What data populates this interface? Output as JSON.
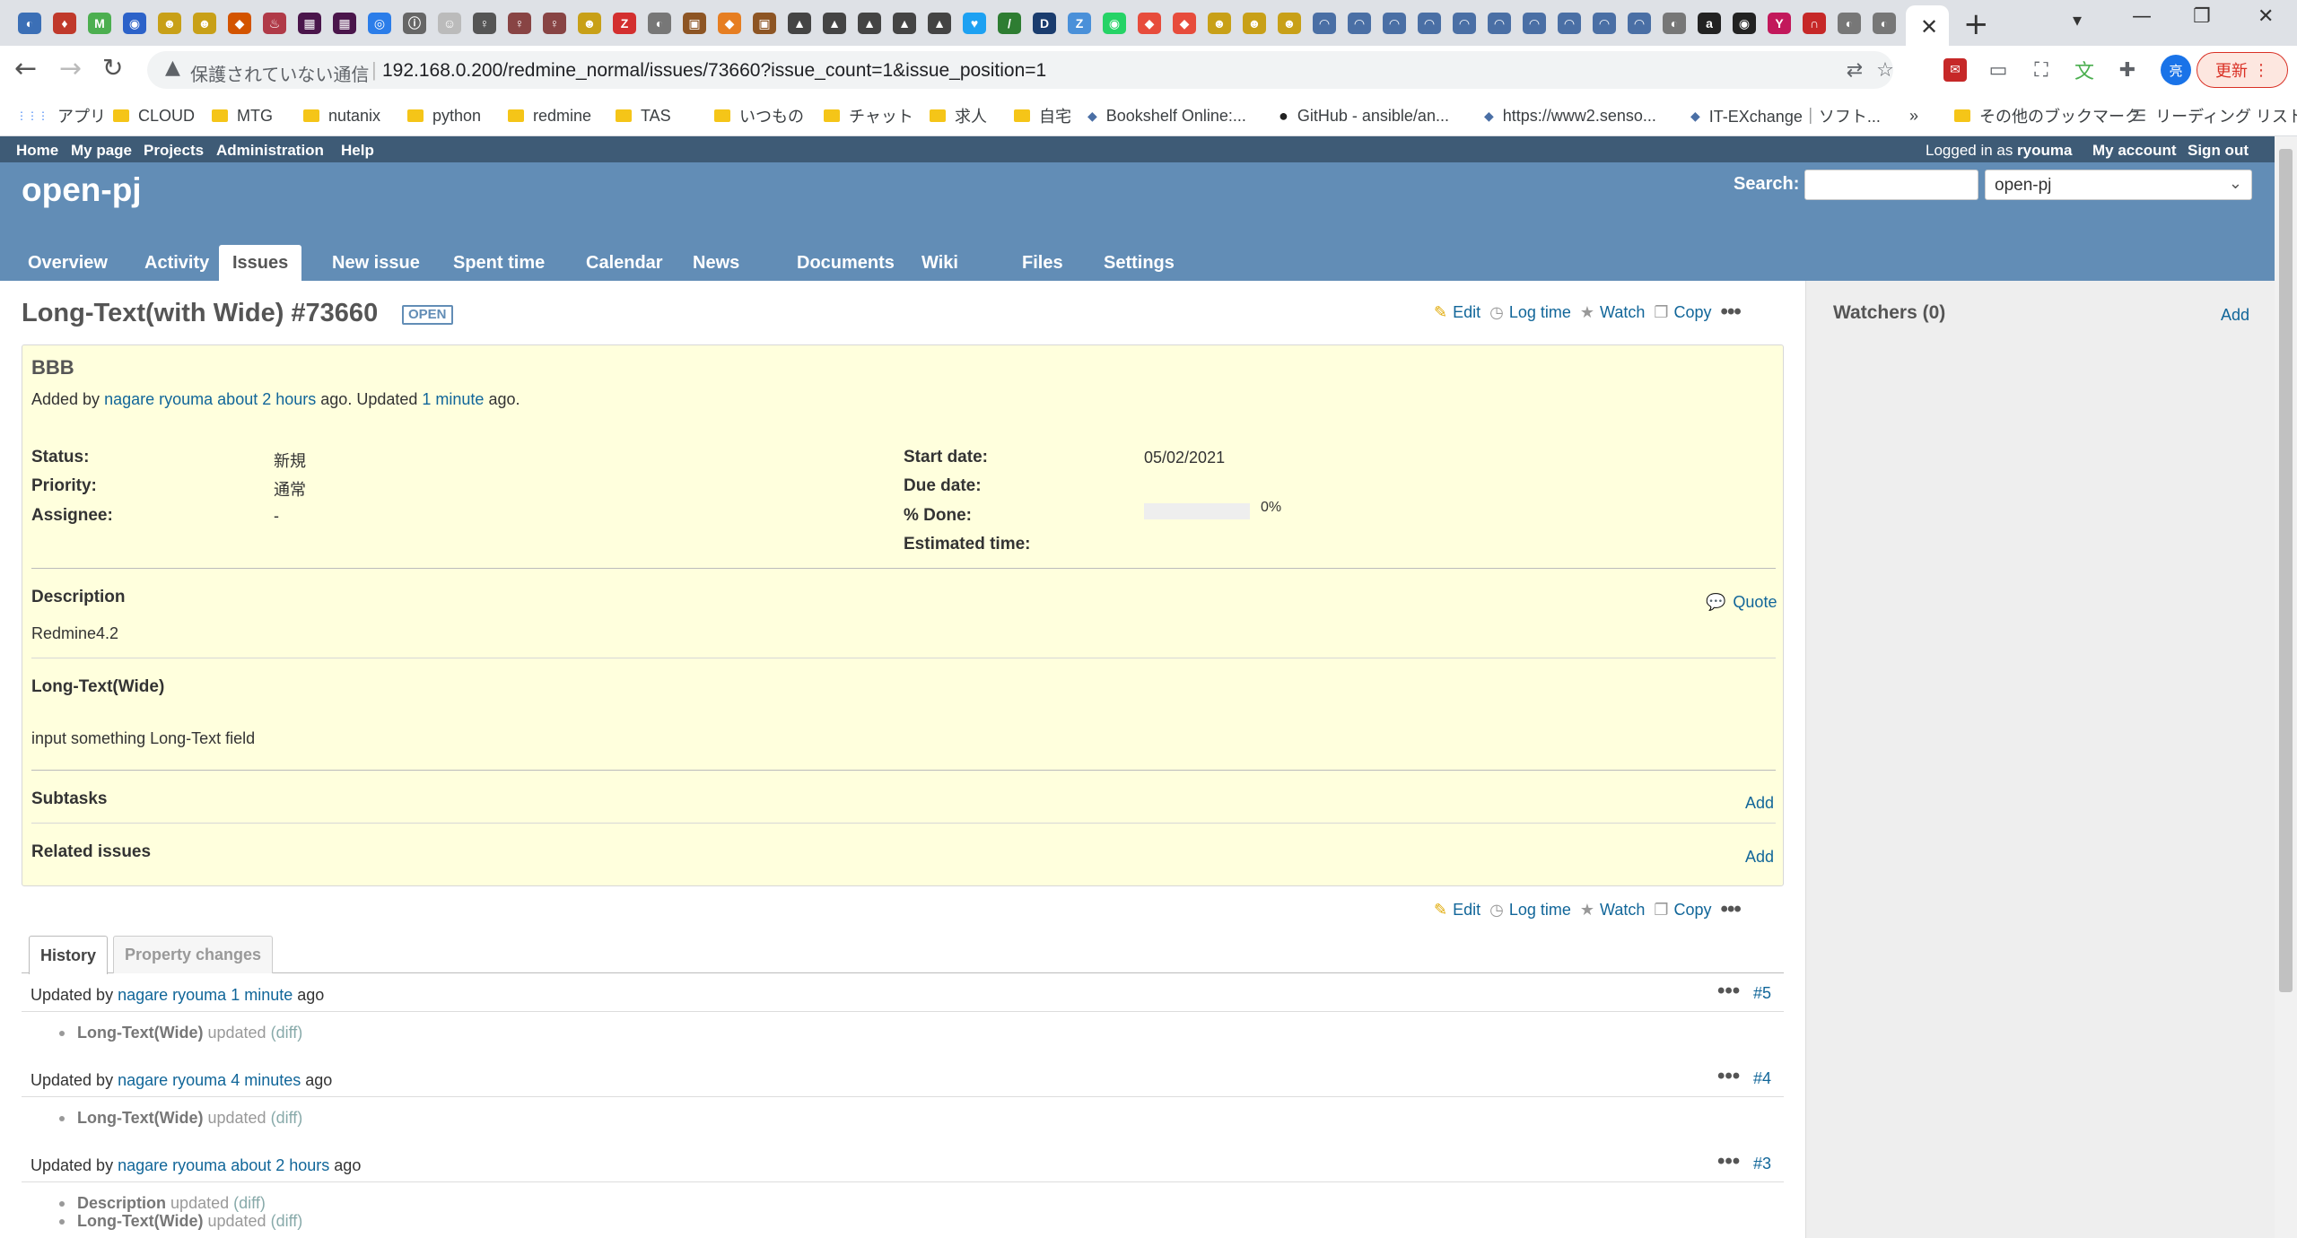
{
  "browser": {
    "window_controls": {
      "minimize": "—",
      "maximize": "❐",
      "close": "✕"
    },
    "tab_icons": [
      {
        "glyph": "◐",
        "bg": "#3b6fb6"
      },
      {
        "glyph": "♦",
        "bg": "#c0392b"
      },
      {
        "glyph": "M",
        "bg": "#4caf50"
      },
      {
        "glyph": "◉",
        "bg": "#2c62c9"
      },
      {
        "glyph": "☻",
        "bg": "#c8a018"
      },
      {
        "glyph": "☻",
        "bg": "#c8a018"
      },
      {
        "glyph": "◆",
        "bg": "#d35400"
      },
      {
        "glyph": "♨",
        "bg": "#b03a48"
      },
      {
        "glyph": "▦",
        "bg": "#4a154b"
      },
      {
        "glyph": "▦",
        "bg": "#4a154b"
      },
      {
        "glyph": "◎",
        "bg": "#2b7de9"
      },
      {
        "glyph": "ⓘ",
        "bg": "#666666"
      },
      {
        "glyph": "☺",
        "bg": "#bbbbbb"
      },
      {
        "glyph": "♀",
        "bg": "#555555"
      },
      {
        "glyph": "♀",
        "bg": "#884444"
      },
      {
        "glyph": "♀",
        "bg": "#884444"
      },
      {
        "glyph": "☻",
        "bg": "#c8a018"
      },
      {
        "glyph": "Z",
        "bg": "#d32f2f"
      },
      {
        "glyph": "◐",
        "bg": "#777777"
      },
      {
        "glyph": "▣",
        "bg": "#8d5524"
      },
      {
        "glyph": "◆",
        "bg": "#e67e22"
      },
      {
        "glyph": "▣",
        "bg": "#8d5524"
      },
      {
        "glyph": "▲",
        "bg": "#444444"
      },
      {
        "glyph": "▲",
        "bg": "#444444"
      },
      {
        "glyph": "▲",
        "bg": "#444444"
      },
      {
        "glyph": "▲",
        "bg": "#444444"
      },
      {
        "glyph": "▲",
        "bg": "#444444"
      },
      {
        "glyph": "♥",
        "bg": "#1da1f2"
      },
      {
        "glyph": "/",
        "bg": "#2e7d32"
      },
      {
        "glyph": "D",
        "bg": "#1a3c6e"
      },
      {
        "glyph": "Z",
        "bg": "#4a90d9"
      },
      {
        "glyph": "◉",
        "bg": "#25d366"
      },
      {
        "glyph": "◆",
        "bg": "#e74c3c"
      },
      {
        "glyph": "◆",
        "bg": "#e74c3c"
      },
      {
        "glyph": "☻",
        "bg": "#c8a018"
      },
      {
        "glyph": "☻",
        "bg": "#c8a018"
      },
      {
        "glyph": "☻",
        "bg": "#c8a018"
      },
      {
        "glyph": "◠",
        "bg": "#4a6fa5"
      },
      {
        "glyph": "◠",
        "bg": "#4a6fa5"
      },
      {
        "glyph": "◠",
        "bg": "#4a6fa5"
      },
      {
        "glyph": "◠",
        "bg": "#4a6fa5"
      },
      {
        "glyph": "◠",
        "bg": "#4a6fa5"
      },
      {
        "glyph": "◠",
        "bg": "#4a6fa5"
      },
      {
        "glyph": "◠",
        "bg": "#4a6fa5"
      },
      {
        "glyph": "◠",
        "bg": "#4a6fa5"
      },
      {
        "glyph": "◠",
        "bg": "#4a6fa5"
      },
      {
        "glyph": "◠",
        "bg": "#4a6fa5"
      },
      {
        "glyph": "◐",
        "bg": "#777777"
      },
      {
        "glyph": "a",
        "bg": "#222222"
      },
      {
        "glyph": "◉",
        "bg": "#222222"
      },
      {
        "glyph": "Y",
        "bg": "#c2185b"
      },
      {
        "glyph": "∩",
        "bg": "#c62828"
      },
      {
        "glyph": "◐",
        "bg": "#777777"
      },
      {
        "glyph": "◐",
        "bg": "#777777"
      }
    ],
    "active_tab_close": "✕",
    "new_tab": "+",
    "tab_search": "▾",
    "nav": {
      "back": "←",
      "forward": "→",
      "reload": "↻"
    },
    "omnibox": {
      "warning": "▲",
      "security_text": "保護されていない通信",
      "url": "192.168.0.200/redmine_normal/issues/73660?issue_count=1&issue_position=1"
    },
    "profile_initial": "亮",
    "update_button": "更新",
    "update_menu": "⋮",
    "bookmarks": [
      {
        "label": "アプリ",
        "kind": "apps"
      },
      {
        "label": "CLOUD",
        "kind": "folder"
      },
      {
        "label": "MTG",
        "kind": "folder"
      },
      {
        "label": "nutanix",
        "kind": "folder"
      },
      {
        "label": "python",
        "kind": "folder"
      },
      {
        "label": "redmine",
        "kind": "folder"
      },
      {
        "label": "TAS",
        "kind": "folder"
      },
      {
        "label": "いつもの",
        "kind": "folder"
      },
      {
        "label": "チャット",
        "kind": "folder"
      },
      {
        "label": "求人",
        "kind": "folder"
      },
      {
        "label": "自宅",
        "kind": "folder"
      },
      {
        "label": "Bookshelf Online:...",
        "kind": "page"
      },
      {
        "label": "GitHub - ansible/an...",
        "kind": "github"
      },
      {
        "label": "https://www2.senso...",
        "kind": "page"
      },
      {
        "label": "IT-EXchange｜ソフト...",
        "kind": "page"
      },
      {
        "label": "»",
        "kind": "overflow"
      },
      {
        "label": "その他のブックマーク",
        "kind": "folder"
      },
      {
        "label": "リーディング リスト",
        "kind": "reading"
      }
    ]
  },
  "top_menu": {
    "left": [
      "Home",
      "My page",
      "Projects",
      "Administration",
      "Help"
    ],
    "logged_in_prefix": "Logged in as",
    "user": "ryouma",
    "my_account": "My account",
    "sign_out": "Sign out"
  },
  "header": {
    "project_title": "open-pj",
    "search_label": "Search:",
    "search_value": "",
    "project_select": "open-pj",
    "select_chevron": "⌄",
    "tabs": [
      "Overview",
      "Activity",
      "Issues",
      "New issue",
      "Spent time",
      "Calendar",
      "News",
      "Documents",
      "Wiki",
      "Files",
      "Settings"
    ],
    "selected_tab": "Issues"
  },
  "issue": {
    "title": "Long-Text(with Wide) #73660",
    "status_badge": "OPEN",
    "actions": {
      "edit": "Edit",
      "log_time": "Log time",
      "watch": "Watch",
      "copy": "Copy",
      "more": "•••"
    },
    "subject": "BBB",
    "author_prefix": "Added by",
    "author": "nagare ryouma",
    "created": "about 2 hours",
    "mid_text": "ago. Updated",
    "updated": "1 minute",
    "end_text": "ago.",
    "attributes_left": [
      {
        "label": "Status:",
        "value": "新規"
      },
      {
        "label": "Priority:",
        "value": "通常"
      },
      {
        "label": "Assignee:",
        "value": "-"
      }
    ],
    "attributes_right": [
      {
        "label": "Start date:",
        "value": "05/02/2021"
      },
      {
        "label": "Due date:",
        "value": ""
      },
      {
        "label": "% Done:",
        "value": "0%"
      },
      {
        "label": "Estimated time:",
        "value": ""
      }
    ],
    "done_ratio": 0,
    "description_title": "Description",
    "quote": "Quote",
    "description": "Redmine4.2",
    "custom_field_title": "Long-Text(Wide)",
    "custom_field_value": "input something Long-Text field",
    "subtasks_title": "Subtasks",
    "subtasks_add": "Add",
    "related_title": "Related issues",
    "related_add": "Add"
  },
  "history": {
    "tabs": [
      "History",
      "Property changes"
    ],
    "journals": [
      {
        "prefix": "Updated by",
        "author": "nagare ryouma",
        "when": "1 minute",
        "suffix": "ago",
        "num": "#5",
        "details": [
          {
            "field": "Long-Text(Wide)",
            "text": "updated",
            "diff": "(diff)"
          }
        ]
      },
      {
        "prefix": "Updated by",
        "author": "nagare ryouma",
        "when": "4 minutes",
        "suffix": "ago",
        "num": "#4",
        "details": [
          {
            "field": "Long-Text(Wide)",
            "text": "updated",
            "diff": "(diff)"
          }
        ]
      },
      {
        "prefix": "Updated by",
        "author": "nagare ryouma",
        "when": "about 2 hours",
        "suffix": "ago",
        "num": "#3",
        "details": [
          {
            "field": "Description",
            "text": "updated",
            "diff": "(diff)"
          },
          {
            "field": "Long-Text(Wide)",
            "text": "updated",
            "diff": "(diff)"
          }
        ]
      }
    ]
  },
  "sidebar": {
    "watchers_title": "Watchers (0)",
    "add": "Add"
  },
  "colors": {
    "header": "#628db6",
    "top_menu": "#3e5b76",
    "issue_bg": "#ffffdd",
    "link": "#169"
  }
}
